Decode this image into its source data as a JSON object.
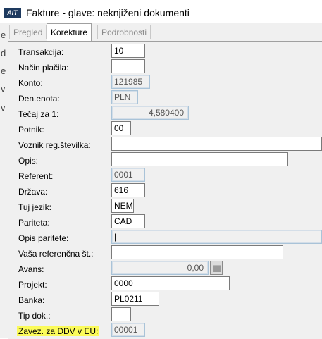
{
  "window": {
    "logo_text": "AIT",
    "title": "Fakture - glave: neknjiženi dokumenti"
  },
  "background_window": {
    "letters": [
      "e",
      "d",
      "e",
      "v",
      "v"
    ]
  },
  "tabs": [
    {
      "label": "Pregled",
      "active": false
    },
    {
      "label": "Korekture",
      "active": true
    },
    {
      "label": "Podrobnosti",
      "active": false
    }
  ],
  "form": {
    "transakcija": {
      "label": "Transakcija:",
      "value": "10"
    },
    "nacin_placila": {
      "label": "Način plačila:",
      "value": ""
    },
    "konto": {
      "label": "Konto:",
      "value": "121985"
    },
    "den_enota": {
      "label": "Den.enota:",
      "value": "PLN"
    },
    "tecaj": {
      "label": "Tečaj za 1:",
      "value": "4,580400"
    },
    "potnik": {
      "label": "Potnik:",
      "value": "00"
    },
    "voznik": {
      "label": "Voznik reg.številka:",
      "value": ""
    },
    "opis": {
      "label": "Opis:",
      "value": ""
    },
    "referent": {
      "label": "Referent:",
      "value": "0001"
    },
    "drzava": {
      "label": "Država:",
      "value": "616"
    },
    "tuj_jezik": {
      "label": "Tuj jezik:",
      "value": "NEM"
    },
    "pariteta": {
      "label": "Pariteta:",
      "value": "CAD"
    },
    "opis_paritete": {
      "label": "Opis paritete:",
      "value": "|"
    },
    "vasa_ref": {
      "label": "Vaša referenčna št.:",
      "value": ""
    },
    "avans": {
      "label": "Avans:",
      "value": "0,00"
    },
    "projekt": {
      "label": "Projekt:",
      "value": "0000"
    },
    "banka": {
      "label": "Banka:",
      "value": "PL0211"
    },
    "tip_dok": {
      "label": "Tip dok.:",
      "value": ""
    },
    "zavez_ddv": {
      "label": "Zavez. za DDV v EU:",
      "value": "00001"
    }
  },
  "colors": {
    "highlight": "#fbfb5a",
    "readonly_border": "#a9c3d8"
  }
}
